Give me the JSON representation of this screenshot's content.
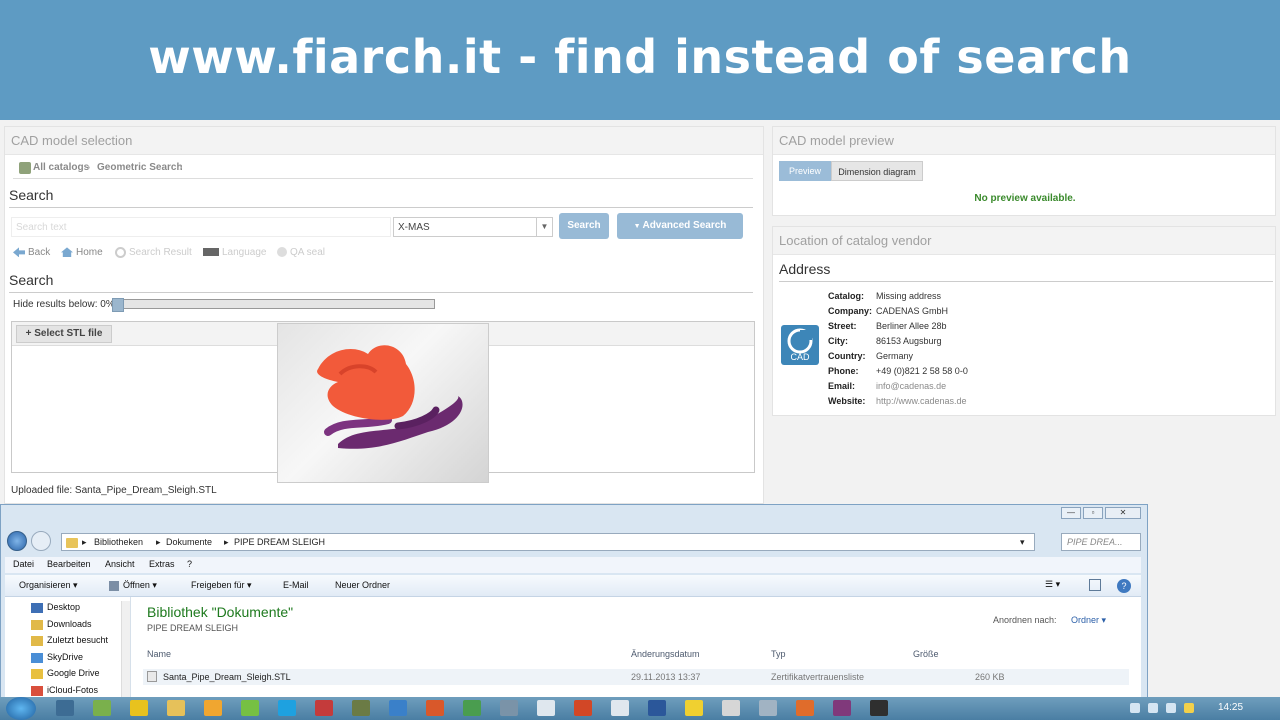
{
  "banner": {
    "text": "www.fiarch.it - find instead of search"
  },
  "selection": {
    "title": "CAD model selection",
    "breadcrumb": [
      "All catalogs",
      "Geometric Search"
    ],
    "search_heading": "Search",
    "search_placeholder": "Search text",
    "catalog_select": "X-MAS",
    "search_button": "Search",
    "advanced_button": "Advanced Search",
    "nav": [
      "Back",
      "Home",
      "Search Result",
      "Language",
      "QA seal"
    ],
    "search_heading2": "Search",
    "slider_label": "Hide results below: 0%",
    "slider_fraction": 0.0,
    "stl_button": "Select STL file",
    "uploaded": "Uploaded file: Santa_Pipe_Dream_Sleigh.STL"
  },
  "preview": {
    "title": "CAD model preview",
    "tabs": [
      "Preview",
      "Dimension diagram"
    ],
    "message": "No preview available."
  },
  "vendor": {
    "title": "Location of catalog vendor",
    "address_heading": "Address",
    "rows": [
      {
        "key": "Catalog:",
        "value": "Missing address"
      },
      {
        "key": "Company:",
        "value": "CADENAS GmbH"
      },
      {
        "key": "Street:",
        "value": "Berliner Allee 28b"
      },
      {
        "key": "City:",
        "value": "86153 Augsburg"
      },
      {
        "key": "Country:",
        "value": "Germany"
      },
      {
        "key": "Phone:",
        "value": "+49 (0)821 2 58 58 0-0"
      },
      {
        "key": "Email:",
        "value": "info@cadenas.de"
      },
      {
        "key": "Website:",
        "value": "http://www.cadenas.de"
      }
    ],
    "logo_text": "CAD"
  },
  "explorer": {
    "window_controls": [
      "—",
      "▫",
      "✕"
    ],
    "path": [
      "Bibliotheken",
      "Dokumente",
      "PIPE DREAM SLEIGH"
    ],
    "search_placeholder": "PIPE DREA...",
    "menu": [
      "Datei",
      "Bearbeiten",
      "Ansicht",
      "Extras",
      "?"
    ],
    "toolbar": [
      "Organisieren ▾",
      "Öffnen ▾",
      "Freigeben für ▾",
      "E-Mail",
      "Neuer Ordner"
    ],
    "nav_items": [
      "Desktop",
      "Downloads",
      "Zuletzt besucht",
      "SkyDrive",
      "Google Drive",
      "iCloud-Fotos"
    ],
    "library_title": "Bibliothek \"Dokumente\"",
    "library_sub": "PIPE DREAM SLEIGH",
    "arrange_label": "Anordnen nach:",
    "arrange_value": "Ordner ▾",
    "columns": [
      "Name",
      "Änderungsdatum",
      "Typ",
      "Größe"
    ],
    "file": {
      "name": "Santa_Pipe_Dream_Sleigh.STL",
      "date": "29.11.2013 13:37",
      "type": "Zertifikatvertrauensliste",
      "size": "260 KB"
    }
  },
  "taskbar": {
    "clock": "14:25"
  }
}
